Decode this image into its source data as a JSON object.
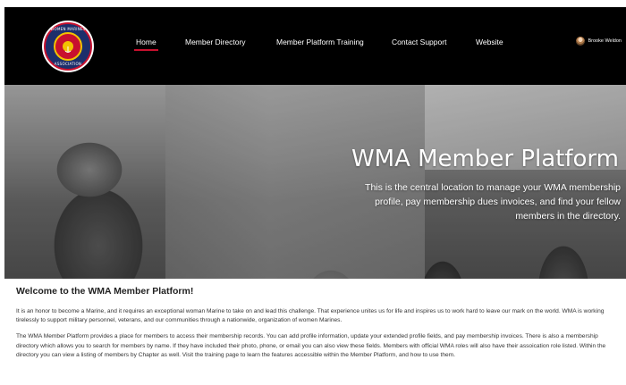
{
  "nav": {
    "links": [
      "Home",
      "Member Directory",
      "Member Platform Training",
      "Contact Support",
      "Website"
    ],
    "active": "Home",
    "user_name": "Brooke Weldon"
  },
  "logo": {
    "top_text": "WOMEN MARINES",
    "bottom_text": "ASSOCIATION"
  },
  "hero": {
    "title": "WMA Member Platform",
    "subtitle": "This is the central location to manage your WMA membership profile, pay membership dues invoices, and find your fellow members in the directory."
  },
  "content": {
    "welcome": "Welcome to the WMA Member Platform!",
    "paragraph1": "It is an honor to become a Marine, and it requires an exceptional woman Marine to take on and lead this challenge. That experience unites us for life and inspires us to work hard to leave our mark on the world. WMA is working tirelessly to support military personnel, veterans, and our communities through a nationwide, organization of women Marines.",
    "paragraph2": "The WMA Member Platform provides a place for members to access their membership records. You can add profile information, update your extended profile fields, and pay membership invoices. There is also a membership directory which allows you to search for members by name. If they have included their photo, phone, or email you can also view these fields. Members with official WMA roles will also have their assoication role listed. Within the directory you can view a listing of members by Chapter as well. Visit the training page to learn the features accessible within the Member Platform, and how to use them."
  },
  "colors": {
    "nav_bg": "#000000",
    "active_underline": "#c8102e"
  }
}
